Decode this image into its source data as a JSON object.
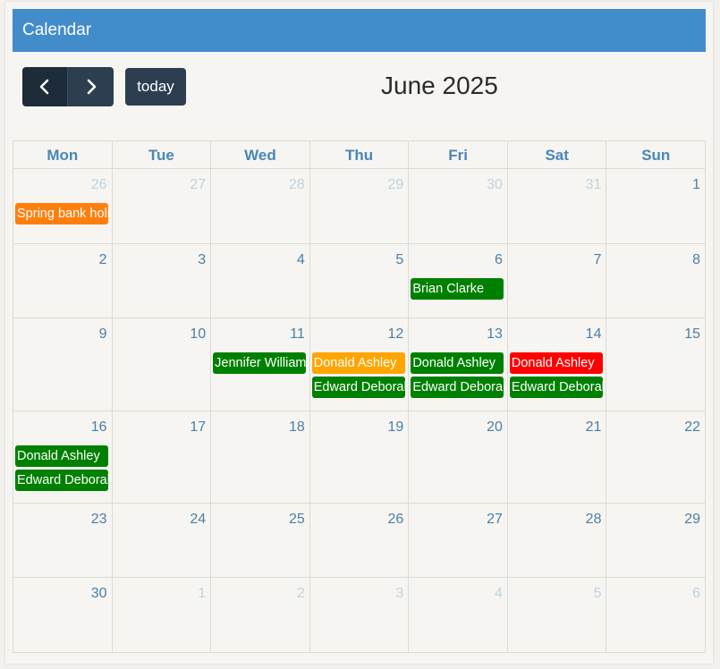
{
  "header": {
    "title": "Calendar"
  },
  "toolbar": {
    "prev_icon": "chevron-left-icon",
    "next_icon": "chevron-right-icon",
    "today_label": "today",
    "title": "June 2025"
  },
  "colors": {
    "header_bg": "#438ccb",
    "button_bg": "#2c3e50",
    "event_green": "#008000",
    "event_orange": "#ff7f0e",
    "event_amber": "#ffa500",
    "event_red": "#ff0000"
  },
  "weekdays": [
    "Mon",
    "Tue",
    "Wed",
    "Thu",
    "Fri",
    "Sat",
    "Sun"
  ],
  "weeks": [
    {
      "days": [
        "26",
        "27",
        "28",
        "29",
        "30",
        "31",
        "1"
      ],
      "other": [
        true,
        true,
        true,
        true,
        true,
        true,
        false
      ]
    },
    {
      "days": [
        "2",
        "3",
        "4",
        "5",
        "6",
        "7",
        "8"
      ],
      "other": [
        false,
        false,
        false,
        false,
        false,
        false,
        false
      ]
    },
    {
      "days": [
        "9",
        "10",
        "11",
        "12",
        "13",
        "14",
        "15"
      ],
      "other": [
        false,
        false,
        false,
        false,
        false,
        false,
        false
      ]
    },
    {
      "days": [
        "16",
        "17",
        "18",
        "19",
        "20",
        "21",
        "22"
      ],
      "other": [
        false,
        false,
        false,
        false,
        false,
        false,
        false
      ]
    },
    {
      "days": [
        "23",
        "24",
        "25",
        "26",
        "27",
        "28",
        "29"
      ],
      "other": [
        false,
        false,
        false,
        false,
        false,
        false,
        false
      ]
    },
    {
      "days": [
        "30",
        "1",
        "2",
        "3",
        "4",
        "5",
        "6"
      ],
      "other": [
        false,
        true,
        true,
        true,
        true,
        true,
        true
      ]
    }
  ],
  "events": [
    {
      "week": 0,
      "day": 0,
      "slot": 0,
      "title": "Spring bank holiday",
      "color": "#ff7f0e"
    },
    {
      "week": 1,
      "day": 4,
      "slot": 0,
      "title": "Brian Clarke",
      "color": "#008000"
    },
    {
      "week": 2,
      "day": 2,
      "slot": 0,
      "title": "Jennifer Williams",
      "color": "#008000"
    },
    {
      "week": 2,
      "day": 3,
      "slot": 0,
      "title": "Donald Ashley",
      "color": "#ffa500"
    },
    {
      "week": 2,
      "day": 3,
      "slot": 1,
      "title": "Edward Deborah",
      "color": "#008000"
    },
    {
      "week": 2,
      "day": 4,
      "slot": 0,
      "title": "Donald Ashley",
      "color": "#008000"
    },
    {
      "week": 2,
      "day": 4,
      "slot": 1,
      "title": "Edward Deborah",
      "color": "#008000"
    },
    {
      "week": 2,
      "day": 5,
      "slot": 0,
      "title": "Donald Ashley",
      "color": "#ff0000"
    },
    {
      "week": 2,
      "day": 5,
      "slot": 1,
      "title": "Edward Deborah",
      "color": "#008000"
    },
    {
      "week": 3,
      "day": 0,
      "slot": 0,
      "title": "Donald Ashley",
      "color": "#008000"
    },
    {
      "week": 3,
      "day": 0,
      "slot": 1,
      "title": "Edward Deborah",
      "color": "#008000"
    }
  ]
}
